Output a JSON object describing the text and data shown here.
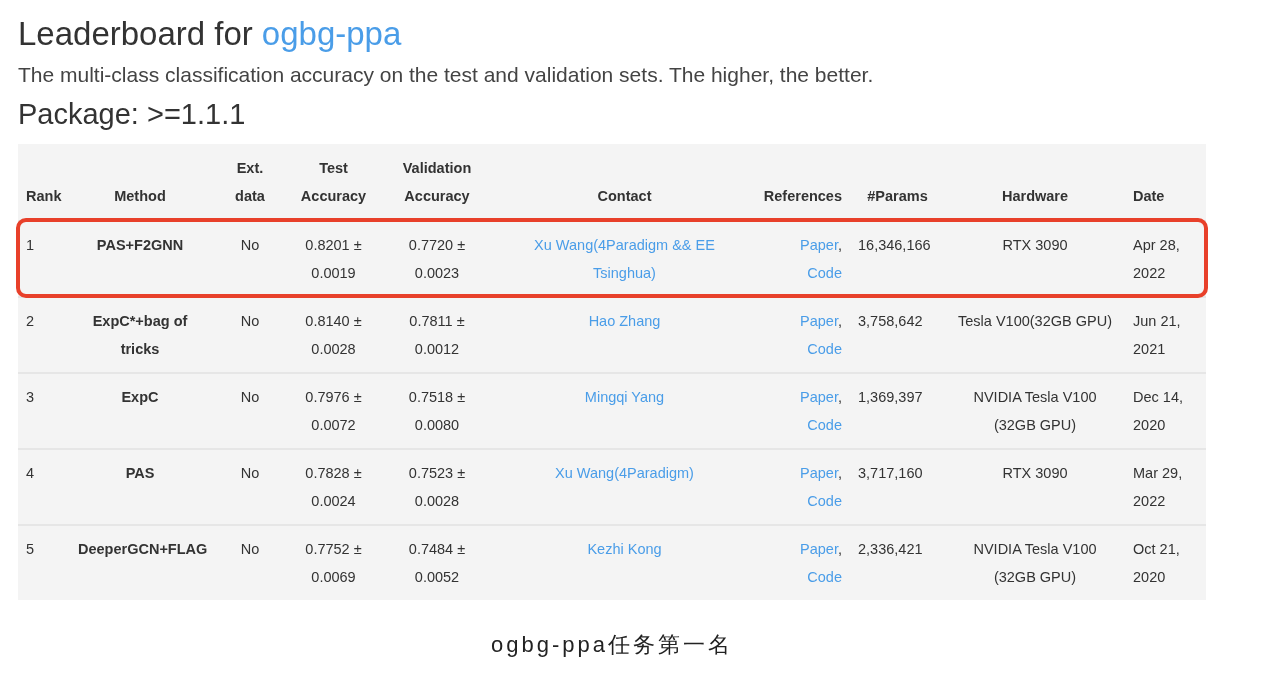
{
  "title": {
    "prefix": "Leaderboard for",
    "dataset_link": "ogbg-ppa"
  },
  "description": "The multi-class classification accuracy on the test and validation sets. The higher, the better.",
  "package": "Package: >=1.1.1",
  "table": {
    "columns": [
      {
        "lines": [
          "Rank"
        ]
      },
      {
        "lines": [
          "Method"
        ]
      },
      {
        "lines": [
          "Ext.",
          "data"
        ]
      },
      {
        "lines": [
          "Test",
          "Accuracy"
        ]
      },
      {
        "lines": [
          "Validation",
          "Accuracy"
        ]
      },
      {
        "lines": [
          "Contact"
        ]
      },
      {
        "lines": [
          "References"
        ]
      },
      {
        "lines": [
          "#Params"
        ]
      },
      {
        "lines": [
          "Hardware"
        ]
      },
      {
        "lines": [
          "Date"
        ]
      }
    ],
    "rows": [
      {
        "rank": "1",
        "method": "PAS+F2GNN",
        "ext_data": "No",
        "test": "0.8201 ± 0.0019",
        "validation": "0.7720 ± 0.0023",
        "contact": "Xu Wang(4Paradigm && EE Tsinghua)",
        "references": {
          "paper": "Paper",
          "separator": ",",
          "code": "Code"
        },
        "params": "16,346,166",
        "hardware": "RTX 3090",
        "date": "Apr 28, 2022",
        "highlighted": true
      },
      {
        "rank": "2",
        "method": "ExpC*+bag of tricks",
        "ext_data": "No",
        "test": "0.8140 ± 0.0028",
        "validation": "0.7811 ± 0.0012",
        "contact": "Hao Zhang",
        "references": {
          "paper": "Paper",
          "separator": ",",
          "code": "Code"
        },
        "params": "3,758,642",
        "hardware": "Tesla V100(32GB GPU)",
        "date": "Jun 21, 2021",
        "highlighted": false
      },
      {
        "rank": "3",
        "method": "ExpC",
        "ext_data": "No",
        "test": "0.7976 ± 0.0072",
        "validation": "0.7518 ± 0.0080",
        "contact": "Mingqi Yang",
        "references": {
          "paper": "Paper",
          "separator": ",",
          "code": "Code"
        },
        "params": "1,369,397",
        "hardware": "NVIDIA Tesla V100 (32GB GPU)",
        "date": "Dec 14, 2020",
        "highlighted": false
      },
      {
        "rank": "4",
        "method": "PAS",
        "ext_data": "No",
        "test": "0.7828 ± 0.0024",
        "validation": "0.7523 ± 0.0028",
        "contact": "Xu Wang(4Paradigm)",
        "references": {
          "paper": "Paper",
          "separator": ",",
          "code": "Code"
        },
        "params": "3,717,160",
        "hardware": "RTX 3090",
        "date": "Mar 29, 2022",
        "highlighted": false
      },
      {
        "rank": "5",
        "method": "DeeperGCN+FLAG",
        "ext_data": "No",
        "test": "0.7752 ± 0.0069",
        "validation": "0.7484 ± 0.0052",
        "contact": "Kezhi Kong",
        "references": {
          "paper": "Paper",
          "separator": ",",
          "code": "Code"
        },
        "params": "2,336,421",
        "hardware": "NVIDIA Tesla V100 (32GB GPU)",
        "date": "Oct 21, 2020",
        "highlighted": false
      }
    ]
  },
  "caption": "ogbg-ppa任务第一名"
}
